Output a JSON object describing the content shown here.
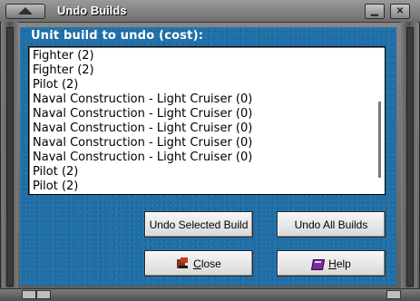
{
  "window": {
    "title": "Undo Builds",
    "minimize_glyph": "▁",
    "close_glyph": "✕"
  },
  "list": {
    "label": "Unit build to undo (cost):",
    "items": [
      "Fighter (2)",
      "Fighter (2)",
      "Pilot (2)",
      "Naval Construction - Light Cruiser (0)",
      "Naval Construction - Light Cruiser (0)",
      "Naval Construction - Light Cruiser (0)",
      "Naval Construction - Light Cruiser (0)",
      "Naval Construction - Light Cruiser (0)",
      "Pilot (2)",
      "Pilot (2)"
    ]
  },
  "buttons": {
    "undo_selected": "Undo Selected Build",
    "undo_all": "Undo All Builds",
    "close_mnemonic": "C",
    "close_rest": "lose",
    "help_mnemonic": "H",
    "help_rest": "elp"
  },
  "icons": {
    "close": "close-door-icon",
    "help": "help-book-icon"
  },
  "colors": {
    "panel": "#1f6fa8",
    "frame": "#6b6b6b"
  }
}
